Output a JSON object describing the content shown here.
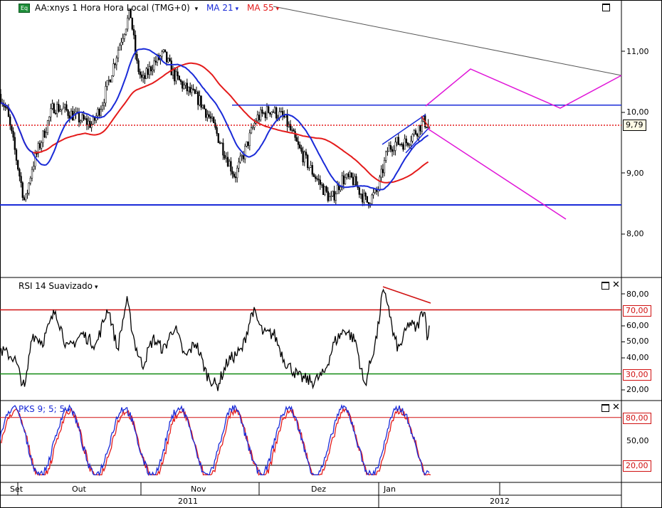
{
  "header": {
    "badge": "Eq",
    "symbol": "AA:xnys 1 Hora Hora Local (TMG+0)",
    "ma21_label": "MA 21",
    "ma55_label": "MA 55"
  },
  "rsi_panel": {
    "title": "RSI 14 Suavizado"
  },
  "pks_panel": {
    "title": "PKS 9; 5; 5"
  },
  "price_axis": [
    "11,00",
    "10,00",
    "9,00",
    "8,00"
  ],
  "rsi_axis": [
    "80,00",
    "70,00",
    "60,00",
    "50,00",
    "40,00",
    "30,00",
    "20,00"
  ],
  "pks_axis": [
    "80,00",
    "50,00",
    "20,00"
  ],
  "last_price": "9,79",
  "rsi_levels": [
    "70,00",
    "30,00"
  ],
  "pks_levels": [
    "80,00",
    "20,00"
  ],
  "months": [
    "Set",
    "Out",
    "Nov",
    "Dez",
    "Jan"
  ],
  "years": [
    "2011",
    "2012"
  ],
  "colors": {
    "ma21": "#1a2bd8",
    "ma55": "#e41b1b",
    "projection": "#e014d8",
    "support": "#1a2bd8",
    "rsi_upper": "#d01010",
    "rsi_lower": "#128a12",
    "badge_bg": "#1f8f3a"
  },
  "chart_data": [
    {
      "type": "line",
      "title": "AA:xnys 1 Hora Hora Local (TMG+0)",
      "series": [
        {
          "name": "MA 21"
        },
        {
          "name": "MA 55"
        }
      ],
      "ylim": [
        7.3,
        11.8
      ],
      "x": [
        "Set",
        "Out",
        "Nov",
        "Dez",
        "Jan",
        "2012"
      ],
      "key_levels": {
        "last": 9.79,
        "resistance": 10.12,
        "support": 8.48
      }
    },
    {
      "type": "line",
      "title": "RSI 14 Suavizado",
      "ylim": [
        15,
        87
      ],
      "levels": [
        70,
        30
      ]
    },
    {
      "type": "line",
      "title": "PKS 9; 5; 5",
      "ylim": [
        0,
        100
      ],
      "levels": [
        80,
        20
      ]
    }
  ]
}
